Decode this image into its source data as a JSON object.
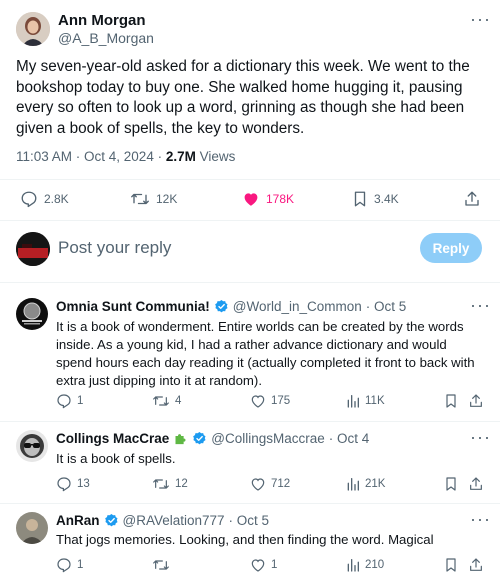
{
  "tweet": {
    "author_name": "Ann Morgan",
    "author_handle": "@A_B_Morgan",
    "text": "My seven-year-old asked for a dictionary this week. We went to the bookshop today to buy one. She walked home hugging it, pausing every so often to look up a word, grinning as though she had been given a book of spells, the key to wonders.",
    "timestamp": "11:03 AM · Oct 4, 2024 · ",
    "views_count": "2.7M",
    "views_label": " Views",
    "actions": {
      "replies": "2.8K",
      "retweets": "12K",
      "likes": "178K",
      "bookmarks": "3.4K"
    },
    "like_color": "#f91880"
  },
  "composer": {
    "placeholder": "Post your reply",
    "button_label": "Reply"
  },
  "replies": [
    {
      "name": "Omnia Sunt Communia!",
      "badge": "verified-blue",
      "handle": "@World_in_Common",
      "date": "· Oct 5",
      "text": "It is a book of wonderment. Entire worlds can be created by the words inside. As a young kid, I had a rather advance dictionary and would spend hours each day reading it (actually completed it front to back with extra just dipping into it at random).",
      "replies": "1",
      "retweets": "4",
      "likes": "175",
      "views": "11K"
    },
    {
      "name": "Collings MacCrae",
      "badge": "puzzle-piece-emoji, verified-blue",
      "handle": "@CollingsMaccrae",
      "date": "· Oct 4",
      "text": "It is a book of spells.",
      "replies": "13",
      "retweets": "12",
      "likes": "712",
      "views": "21K"
    },
    {
      "name": "AnRan",
      "badge": "verified-blue",
      "handle": "@RAVelation777",
      "date": "· Oct 5",
      "text": "That jogs memories. Looking, and then finding the word. Magical",
      "replies": "1",
      "retweets": "",
      "likes": "1",
      "views": "210"
    }
  ],
  "colors": {
    "verified": "#1d9bf0",
    "reply_button": "#8ecdf8",
    "text_secondary": "#536471"
  }
}
